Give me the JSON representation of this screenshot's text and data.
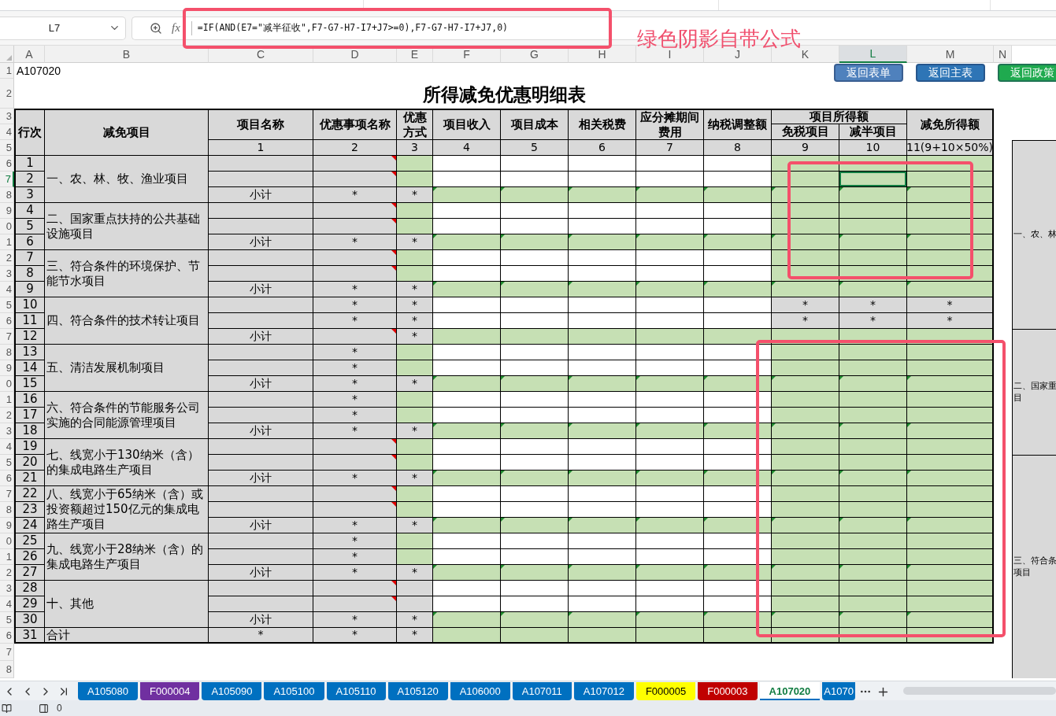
{
  "formula_bar": {
    "name_box": "L7",
    "function_label": "fx",
    "formula": "=IF(AND(E7=\"减半征收\",F7-G7-H7-I7+J7>=0),F7-G7-H7-I7+J7,0)"
  },
  "annotation": "绿色阴影自带公式",
  "column_letters": [
    {
      "label": "A",
      "selected": false
    },
    {
      "label": "B",
      "selected": false
    },
    {
      "label": "C",
      "selected": false
    },
    {
      "label": "D",
      "selected": false
    },
    {
      "label": "E",
      "selected": false
    },
    {
      "label": "F",
      "selected": false
    },
    {
      "label": "G",
      "selected": false
    },
    {
      "label": "H",
      "selected": false
    },
    {
      "label": "I",
      "selected": false
    },
    {
      "label": "J",
      "selected": false
    },
    {
      "label": "K",
      "selected": false
    },
    {
      "label": "L",
      "selected": true
    },
    {
      "label": "M",
      "selected": false
    },
    {
      "label": "N",
      "selected": false
    }
  ],
  "row_numbers": [
    {
      "label": "1",
      "selected": false
    },
    {
      "label": "2",
      "selected": false
    },
    {
      "label": "3",
      "selected": false
    },
    {
      "label": "4",
      "selected": false
    },
    {
      "label": "5",
      "selected": false
    },
    {
      "label": "6",
      "selected": false
    },
    {
      "label": "7",
      "selected": true
    },
    {
      "label": "8",
      "selected": false
    },
    {
      "label": "9",
      "selected": false
    },
    {
      "label": "0",
      "selected": false
    },
    {
      "label": "1",
      "selected": false
    },
    {
      "label": "2",
      "selected": false
    },
    {
      "label": "3",
      "selected": false
    },
    {
      "label": "4",
      "selected": false
    },
    {
      "label": "5",
      "selected": false
    },
    {
      "label": "6",
      "selected": false
    },
    {
      "label": "7",
      "selected": false
    },
    {
      "label": "8",
      "selected": false
    },
    {
      "label": "9",
      "selected": false
    },
    {
      "label": "0",
      "selected": false
    },
    {
      "label": "1",
      "selected": false
    },
    {
      "label": "2",
      "selected": false
    },
    {
      "label": "3",
      "selected": false
    },
    {
      "label": "4",
      "selected": false
    },
    {
      "label": "5",
      "selected": false
    },
    {
      "label": "6",
      "selected": false
    },
    {
      "label": "7",
      "selected": false
    },
    {
      "label": "8",
      "selected": false
    },
    {
      "label": "9",
      "selected": false
    },
    {
      "label": "0",
      "selected": false
    },
    {
      "label": "1",
      "selected": false
    },
    {
      "label": "2",
      "selected": false
    },
    {
      "label": "3",
      "selected": false
    },
    {
      "label": "4",
      "selected": false
    },
    {
      "label": "5",
      "selected": false
    },
    {
      "label": "6",
      "selected": false
    },
    {
      "label": "7",
      "selected": false
    },
    {
      "label": "8",
      "selected": false
    }
  ],
  "sheet_code": "A107020",
  "buttons": [
    {
      "label": "返回表单",
      "color": "#4f81bd"
    },
    {
      "label": "返回主表",
      "color": "#2e75b6"
    },
    {
      "label": "返回政策",
      "color": "#1faa4f"
    }
  ],
  "title": "所得减免优惠明细表",
  "table": {
    "group_label": "项目所得额",
    "columns": [
      {
        "label": "行次"
      },
      {
        "label": "减免项目"
      },
      {
        "label": "项目名称",
        "number": "1"
      },
      {
        "label": "优惠事项名称",
        "number": "2"
      },
      {
        "label": "优惠方式",
        "number": "3"
      },
      {
        "label": "项目收入",
        "number": "4"
      },
      {
        "label": "项目成本",
        "number": "5"
      },
      {
        "label": "相关税费",
        "number": "6"
      },
      {
        "label": "应分摊期间费用",
        "number": "7"
      },
      {
        "label": "纳税调整额",
        "number": "8"
      },
      {
        "label": "免税项目",
        "number": "9"
      },
      {
        "label": "减半项目",
        "number": "10"
      },
      {
        "label": "减免所得额",
        "number": "11(9+10×50%)"
      }
    ],
    "sections": [
      {
        "label": "一、农、林、牧、渔业项目",
        "rows": [
          {
            "no": "1",
            "note": true,
            "marked": false,
            "cells": [
              {
                "kind": "locked"
              },
              {
                "kind": "locked"
              },
              {
                "kind": "formula"
              },
              {
                "kind": "input"
              },
              {
                "kind": "input"
              },
              {
                "kind": "input"
              },
              {
                "kind": "input"
              },
              {
                "kind": "input"
              },
              {
                "kind": "formula"
              },
              {
                "kind": "formula"
              },
              {
                "kind": "formula"
              }
            ]
          },
          {
            "no": "2",
            "note": true,
            "marked": false,
            "cells": [
              {
                "kind": "locked"
              },
              {
                "kind": "locked"
              },
              {
                "kind": "formula"
              },
              {
                "kind": "input"
              },
              {
                "kind": "input"
              },
              {
                "kind": "input"
              },
              {
                "kind": "input"
              },
              {
                "kind": "input"
              },
              {
                "kind": "formula"
              },
              {
                "kind": "formula"
              },
              {
                "kind": "formula"
              }
            ]
          },
          {
            "no": "3",
            "note": false,
            "marked": true,
            "cells": [
              {
                "kind": "locked",
                "text": "小计"
              },
              {
                "kind": "locked",
                "text": "*"
              },
              {
                "kind": "locked",
                "text": "*"
              },
              {
                "kind": "formula"
              },
              {
                "kind": "formula"
              },
              {
                "kind": "formula"
              },
              {
                "kind": "formula"
              },
              {
                "kind": "formula"
              },
              {
                "kind": "formula"
              },
              {
                "kind": "formula"
              },
              {
                "kind": "formula"
              }
            ]
          }
        ]
      },
      {
        "label": "二、国家重点扶持的公共基础设施项目",
        "rows": [
          {
            "no": "4",
            "note": true,
            "marked": false,
            "cells": [
              {
                "kind": "locked"
              },
              {
                "kind": "locked"
              },
              {
                "kind": "formula"
              },
              {
                "kind": "input"
              },
              {
                "kind": "input"
              },
              {
                "kind": "input"
              },
              {
                "kind": "input"
              },
              {
                "kind": "input"
              },
              {
                "kind": "formula"
              },
              {
                "kind": "formula"
              },
              {
                "kind": "formula"
              }
            ]
          },
          {
            "no": "5",
            "note": true,
            "marked": false,
            "cells": [
              {
                "kind": "locked"
              },
              {
                "kind": "locked"
              },
              {
                "kind": "formula"
              },
              {
                "kind": "input"
              },
              {
                "kind": "input"
              },
              {
                "kind": "input"
              },
              {
                "kind": "input"
              },
              {
                "kind": "input"
              },
              {
                "kind": "formula"
              },
              {
                "kind": "formula"
              },
              {
                "kind": "formula"
              }
            ]
          },
          {
            "no": "6",
            "note": false,
            "marked": true,
            "cells": [
              {
                "kind": "locked",
                "text": "小计"
              },
              {
                "kind": "locked",
                "text": "*"
              },
              {
                "kind": "locked",
                "text": "*"
              },
              {
                "kind": "formula"
              },
              {
                "kind": "formula"
              },
              {
                "kind": "formula"
              },
              {
                "kind": "formula"
              },
              {
                "kind": "formula"
              },
              {
                "kind": "formula"
              },
              {
                "kind": "formula"
              },
              {
                "kind": "formula"
              }
            ]
          }
        ]
      },
      {
        "label": "三、符合条件的环境保护、节能节水项目",
        "rows": [
          {
            "no": "7",
            "note": true,
            "marked": false,
            "cells": [
              {
                "kind": "locked"
              },
              {
                "kind": "locked"
              },
              {
                "kind": "formula"
              },
              {
                "kind": "input"
              },
              {
                "kind": "input"
              },
              {
                "kind": "input"
              },
              {
                "kind": "input"
              },
              {
                "kind": "input"
              },
              {
                "kind": "formula"
              },
              {
                "kind": "formula"
              },
              {
                "kind": "formula"
              }
            ]
          },
          {
            "no": "8",
            "note": true,
            "marked": false,
            "cells": [
              {
                "kind": "locked"
              },
              {
                "kind": "locked"
              },
              {
                "kind": "formula"
              },
              {
                "kind": "input"
              },
              {
                "kind": "input"
              },
              {
                "kind": "input"
              },
              {
                "kind": "input"
              },
              {
                "kind": "input"
              },
              {
                "kind": "formula"
              },
              {
                "kind": "formula"
              },
              {
                "kind": "formula"
              }
            ]
          },
          {
            "no": "9",
            "note": false,
            "marked": true,
            "cells": [
              {
                "kind": "locked",
                "text": "小计"
              },
              {
                "kind": "locked",
                "text": "*"
              },
              {
                "kind": "locked",
                "text": "*"
              },
              {
                "kind": "formula"
              },
              {
                "kind": "formula"
              },
              {
                "kind": "formula"
              },
              {
                "kind": "formula"
              },
              {
                "kind": "formula"
              },
              {
                "kind": "formula"
              },
              {
                "kind": "formula"
              },
              {
                "kind": "formula"
              }
            ]
          }
        ]
      },
      {
        "label": "四、符合条件的技术转让项目",
        "rows": [
          {
            "no": "10",
            "note": false,
            "marked": false,
            "cells": [
              {
                "kind": "locked"
              },
              {
                "kind": "locked",
                "text": "*"
              },
              {
                "kind": "locked",
                "text": "*"
              },
              {
                "kind": "input"
              },
              {
                "kind": "input"
              },
              {
                "kind": "input"
              },
              {
                "kind": "input"
              },
              {
                "kind": "input"
              },
              {
                "kind": "locked",
                "text": "*"
              },
              {
                "kind": "locked",
                "text": "*"
              },
              {
                "kind": "locked",
                "text": "*"
              }
            ]
          },
          {
            "no": "11",
            "note": false,
            "marked": false,
            "cells": [
              {
                "kind": "locked"
              },
              {
                "kind": "locked",
                "text": "*"
              },
              {
                "kind": "locked",
                "text": "*"
              },
              {
                "kind": "input"
              },
              {
                "kind": "input"
              },
              {
                "kind": "input"
              },
              {
                "kind": "input"
              },
              {
                "kind": "input"
              },
              {
                "kind": "locked",
                "text": "*"
              },
              {
                "kind": "locked",
                "text": "*"
              },
              {
                "kind": "locked",
                "text": "*"
              }
            ]
          },
          {
            "no": "12",
            "note": true,
            "marked": false,
            "cells": [
              {
                "kind": "locked",
                "text": "小计"
              },
              {
                "kind": "locked"
              },
              {
                "kind": "locked",
                "text": "*"
              },
              {
                "kind": "formula"
              },
              {
                "kind": "formula"
              },
              {
                "kind": "formula"
              },
              {
                "kind": "formula"
              },
              {
                "kind": "formula"
              },
              {
                "kind": "formula"
              },
              {
                "kind": "formula"
              },
              {
                "kind": "formula"
              }
            ]
          }
        ]
      },
      {
        "label": "五、清洁发展机制项目",
        "rows": [
          {
            "no": "13",
            "note": false,
            "marked": false,
            "cells": [
              {
                "kind": "locked"
              },
              {
                "kind": "locked",
                "text": "*"
              },
              {
                "kind": "formula"
              },
              {
                "kind": "input"
              },
              {
                "kind": "input"
              },
              {
                "kind": "input"
              },
              {
                "kind": "input"
              },
              {
                "kind": "input"
              },
              {
                "kind": "formula"
              },
              {
                "kind": "formula"
              },
              {
                "kind": "formula"
              }
            ]
          },
          {
            "no": "14",
            "note": false,
            "marked": false,
            "cells": [
              {
                "kind": "locked"
              },
              {
                "kind": "locked",
                "text": "*"
              },
              {
                "kind": "formula"
              },
              {
                "kind": "input"
              },
              {
                "kind": "input"
              },
              {
                "kind": "input"
              },
              {
                "kind": "input"
              },
              {
                "kind": "input"
              },
              {
                "kind": "formula"
              },
              {
                "kind": "formula"
              },
              {
                "kind": "formula"
              }
            ]
          },
          {
            "no": "15",
            "note": false,
            "marked": true,
            "cells": [
              {
                "kind": "locked",
                "text": "小计"
              },
              {
                "kind": "locked",
                "text": "*"
              },
              {
                "kind": "locked",
                "text": "*"
              },
              {
                "kind": "formula"
              },
              {
                "kind": "formula"
              },
              {
                "kind": "formula"
              },
              {
                "kind": "formula"
              },
              {
                "kind": "formula"
              },
              {
                "kind": "formula"
              },
              {
                "kind": "formula"
              },
              {
                "kind": "formula"
              }
            ]
          }
        ]
      },
      {
        "label": "六、符合条件的节能服务公司实施的合同能源管理项目",
        "rows": [
          {
            "no": "16",
            "note": false,
            "marked": false,
            "cells": [
              {
                "kind": "locked"
              },
              {
                "kind": "locked",
                "text": "*"
              },
              {
                "kind": "formula"
              },
              {
                "kind": "input"
              },
              {
                "kind": "input"
              },
              {
                "kind": "input"
              },
              {
                "kind": "input"
              },
              {
                "kind": "input"
              },
              {
                "kind": "formula"
              },
              {
                "kind": "formula"
              },
              {
                "kind": "formula"
              }
            ]
          },
          {
            "no": "17",
            "note": false,
            "marked": false,
            "cells": [
              {
                "kind": "locked"
              },
              {
                "kind": "locked",
                "text": "*"
              },
              {
                "kind": "formula"
              },
              {
                "kind": "input"
              },
              {
                "kind": "input"
              },
              {
                "kind": "input"
              },
              {
                "kind": "input"
              },
              {
                "kind": "input"
              },
              {
                "kind": "formula"
              },
              {
                "kind": "formula"
              },
              {
                "kind": "formula"
              }
            ]
          },
          {
            "no": "18",
            "note": false,
            "marked": true,
            "cells": [
              {
                "kind": "locked",
                "text": "小计"
              },
              {
                "kind": "locked",
                "text": "*"
              },
              {
                "kind": "locked",
                "text": "*"
              },
              {
                "kind": "formula"
              },
              {
                "kind": "formula"
              },
              {
                "kind": "formula"
              },
              {
                "kind": "formula"
              },
              {
                "kind": "formula"
              },
              {
                "kind": "formula"
              },
              {
                "kind": "formula"
              },
              {
                "kind": "formula"
              }
            ]
          }
        ]
      },
      {
        "label": "七、线宽小于130纳米（含）的集成电路生产项目",
        "rows": [
          {
            "no": "19",
            "note": true,
            "marked": false,
            "cells": [
              {
                "kind": "locked"
              },
              {
                "kind": "locked"
              },
              {
                "kind": "formula"
              },
              {
                "kind": "input"
              },
              {
                "kind": "input"
              },
              {
                "kind": "input"
              },
              {
                "kind": "input"
              },
              {
                "kind": "input"
              },
              {
                "kind": "formula"
              },
              {
                "kind": "formula"
              },
              {
                "kind": "formula"
              }
            ]
          },
          {
            "no": "20",
            "note": true,
            "marked": false,
            "cells": [
              {
                "kind": "locked"
              },
              {
                "kind": "locked"
              },
              {
                "kind": "formula"
              },
              {
                "kind": "input"
              },
              {
                "kind": "input"
              },
              {
                "kind": "input"
              },
              {
                "kind": "input"
              },
              {
                "kind": "input"
              },
              {
                "kind": "formula"
              },
              {
                "kind": "formula"
              },
              {
                "kind": "formula"
              }
            ]
          },
          {
            "no": "21",
            "note": false,
            "marked": true,
            "cells": [
              {
                "kind": "locked",
                "text": "小计"
              },
              {
                "kind": "locked",
                "text": "*"
              },
              {
                "kind": "locked",
                "text": "*"
              },
              {
                "kind": "formula"
              },
              {
                "kind": "formula"
              },
              {
                "kind": "formula"
              },
              {
                "kind": "formula"
              },
              {
                "kind": "formula"
              },
              {
                "kind": "formula"
              },
              {
                "kind": "formula"
              },
              {
                "kind": "formula"
              }
            ]
          }
        ]
      },
      {
        "label": "八、线宽小于65纳米（含）或投资额超过150亿元的集成电路生产项目",
        "rows": [
          {
            "no": "22",
            "note": true,
            "marked": false,
            "cells": [
              {
                "kind": "locked"
              },
              {
                "kind": "locked"
              },
              {
                "kind": "formula"
              },
              {
                "kind": "input"
              },
              {
                "kind": "input"
              },
              {
                "kind": "input"
              },
              {
                "kind": "input"
              },
              {
                "kind": "input"
              },
              {
                "kind": "formula"
              },
              {
                "kind": "formula"
              },
              {
                "kind": "formula"
              }
            ]
          },
          {
            "no": "23",
            "note": true,
            "marked": false,
            "cells": [
              {
                "kind": "locked"
              },
              {
                "kind": "locked"
              },
              {
                "kind": "formula"
              },
              {
                "kind": "input"
              },
              {
                "kind": "input"
              },
              {
                "kind": "input"
              },
              {
                "kind": "input"
              },
              {
                "kind": "input"
              },
              {
                "kind": "formula"
              },
              {
                "kind": "formula"
              },
              {
                "kind": "formula"
              }
            ]
          },
          {
            "no": "24",
            "note": false,
            "marked": true,
            "cells": [
              {
                "kind": "locked",
                "text": "小计"
              },
              {
                "kind": "locked",
                "text": "*"
              },
              {
                "kind": "locked",
                "text": "*"
              },
              {
                "kind": "formula"
              },
              {
                "kind": "formula"
              },
              {
                "kind": "formula"
              },
              {
                "kind": "formula"
              },
              {
                "kind": "formula"
              },
              {
                "kind": "formula"
              },
              {
                "kind": "formula"
              },
              {
                "kind": "formula"
              }
            ]
          }
        ]
      },
      {
        "label": "九、线宽小于28纳米（含）的集成电路生产项目",
        "rows": [
          {
            "no": "25",
            "note": false,
            "marked": false,
            "cells": [
              {
                "kind": "locked"
              },
              {
                "kind": "locked",
                "text": "*"
              },
              {
                "kind": "formula"
              },
              {
                "kind": "input"
              },
              {
                "kind": "input"
              },
              {
                "kind": "input"
              },
              {
                "kind": "input"
              },
              {
                "kind": "input"
              },
              {
                "kind": "formula"
              },
              {
                "kind": "formula"
              },
              {
                "kind": "formula"
              }
            ]
          },
          {
            "no": "26",
            "note": false,
            "marked": false,
            "cells": [
              {
                "kind": "locked"
              },
              {
                "kind": "locked",
                "text": "*"
              },
              {
                "kind": "formula"
              },
              {
                "kind": "input"
              },
              {
                "kind": "input"
              },
              {
                "kind": "input"
              },
              {
                "kind": "input"
              },
              {
                "kind": "input"
              },
              {
                "kind": "formula"
              },
              {
                "kind": "formula"
              },
              {
                "kind": "formula"
              }
            ]
          },
          {
            "no": "27",
            "note": false,
            "marked": true,
            "cells": [
              {
                "kind": "locked",
                "text": "小计"
              },
              {
                "kind": "locked",
                "text": "*"
              },
              {
                "kind": "locked",
                "text": "*"
              },
              {
                "kind": "formula"
              },
              {
                "kind": "formula"
              },
              {
                "kind": "formula"
              },
              {
                "kind": "formula"
              },
              {
                "kind": "formula"
              },
              {
                "kind": "formula"
              },
              {
                "kind": "formula"
              },
              {
                "kind": "formula"
              }
            ]
          }
        ]
      },
      {
        "label": "十、其他",
        "rows": [
          {
            "no": "28",
            "note": true,
            "marked": false,
            "cells": [
              {
                "kind": "locked"
              },
              {
                "kind": "locked"
              },
              {
                "kind": "locked"
              },
              {
                "kind": "input"
              },
              {
                "kind": "input"
              },
              {
                "kind": "input"
              },
              {
                "kind": "input"
              },
              {
                "kind": "input"
              },
              {
                "kind": "formula"
              },
              {
                "kind": "formula"
              },
              {
                "kind": "formula"
              }
            ]
          },
          {
            "no": "29",
            "note": true,
            "marked": false,
            "cells": [
              {
                "kind": "locked"
              },
              {
                "kind": "locked"
              },
              {
                "kind": "locked"
              },
              {
                "kind": "input"
              },
              {
                "kind": "input"
              },
              {
                "kind": "input"
              },
              {
                "kind": "input"
              },
              {
                "kind": "input"
              },
              {
                "kind": "formula"
              },
              {
                "kind": "formula"
              },
              {
                "kind": "formula"
              }
            ]
          },
          {
            "no": "30",
            "note": false,
            "marked": true,
            "cells": [
              {
                "kind": "locked",
                "text": "小计"
              },
              {
                "kind": "locked",
                "text": "*"
              },
              {
                "kind": "locked",
                "text": "*"
              },
              {
                "kind": "formula"
              },
              {
                "kind": "formula"
              },
              {
                "kind": "formula"
              },
              {
                "kind": "formula"
              },
              {
                "kind": "formula"
              },
              {
                "kind": "formula"
              },
              {
                "kind": "formula"
              },
              {
                "kind": "formula"
              }
            ]
          }
        ]
      },
      {
        "label": "合计",
        "rows": [
          {
            "no": "31",
            "note": false,
            "marked": false,
            "cells": [
              {
                "kind": "locked",
                "text": "*"
              },
              {
                "kind": "locked",
                "text": "*"
              },
              {
                "kind": "locked",
                "text": "*"
              },
              {
                "kind": "formula"
              },
              {
                "kind": "formula"
              },
              {
                "kind": "formula"
              },
              {
                "kind": "formula"
              },
              {
                "kind": "formula"
              },
              {
                "kind": "formula"
              },
              {
                "kind": "formula"
              },
              {
                "kind": "formula"
              }
            ]
          }
        ]
      }
    ]
  },
  "side_panel": [
    {
      "lines": [
        "一、农、林"
      ]
    },
    {
      "lines": [
        "二、国家重",
        "目"
      ]
    },
    {
      "lines": [
        "三、符合条",
        "项目"
      ]
    }
  ],
  "tabs": [
    {
      "label": "A105080",
      "color": "#0070c0",
      "selected": false
    },
    {
      "label": "F000004",
      "color": "#7030a0",
      "selected": false
    },
    {
      "label": "A105090",
      "color": "#0070c0",
      "selected": false
    },
    {
      "label": "A105100",
      "color": "#0070c0",
      "selected": false
    },
    {
      "label": "A105110",
      "color": "#0070c0",
      "selected": false
    },
    {
      "label": "A105120",
      "color": "#0070c0",
      "selected": false
    },
    {
      "label": "A106000",
      "color": "#0070c0",
      "selected": false
    },
    {
      "label": "A107011",
      "color": "#0070c0",
      "selected": false
    },
    {
      "label": "A107012",
      "color": "#0070c0",
      "selected": false
    },
    {
      "label": "F000005",
      "color": "#ffff00",
      "selected": false
    },
    {
      "label": "F000003",
      "color": "#c00000",
      "selected": false
    },
    {
      "label": "A107020",
      "color": "#0070c0",
      "selected": true
    },
    {
      "label": "A1070",
      "color": "#0070c0",
      "selected": false
    }
  ],
  "status_bar": {
    "value": "0"
  }
}
